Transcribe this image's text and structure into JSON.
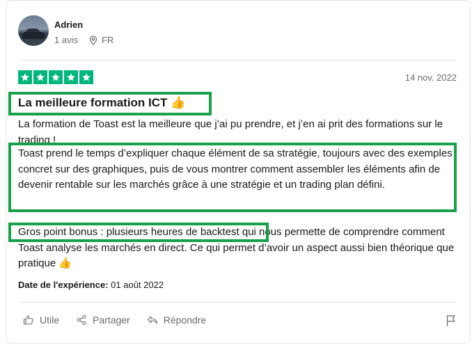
{
  "reviewer": {
    "name": "Adrien",
    "reviews_count": "1 avis",
    "country": "FR"
  },
  "review": {
    "rating": 5,
    "date": "14 nov. 2022",
    "title": "La meilleure formation ICT 👍",
    "paragraphs": [
      "La formation de Toast est la meilleure que j’ai pu prendre, et j’en ai prit des formations sur le trading !",
      "Toast prend le temps d’expliquer chaque élément de sa stratégie, toujours avec des exemples concret sur des graphiques, puis de vous montrer comment assembler les éléments afin de devenir rentable sur les marchés grâce à une stratégie et un trading plan défini.",
      "Gros point bonus : plusieurs heures de backtest qui nous permette de comprendre comment Toast analyse les marchés en direct. Ce qui permet d’avoir un aspect aussi bien théorique que pratique 👍"
    ],
    "experience_label": "Date de l'expérience:",
    "experience_date": "01 août 2022"
  },
  "actions": {
    "useful": "Utile",
    "share": "Partager",
    "reply": "Répondre"
  },
  "colors": {
    "star_green": "#00b67a",
    "highlight_green": "#18a04a",
    "muted_text": "#6b6b6b"
  }
}
